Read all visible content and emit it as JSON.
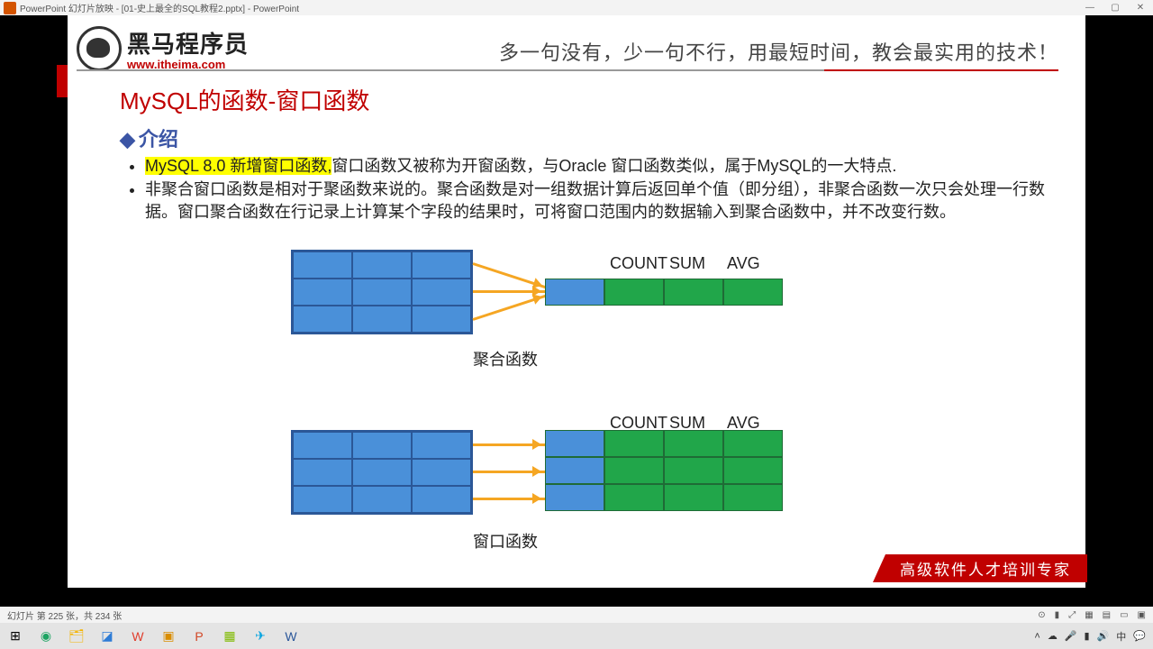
{
  "window": {
    "title": "PowerPoint 幻灯片放映 - [01-史上最全的SQL教程2.pptx] - PowerPoint"
  },
  "brand": {
    "name": "黑马程序员",
    "url": "www.itheima.com"
  },
  "tagline": "多一句没有，少一句不行，用最短时间，教会最实用的技术！",
  "slide": {
    "title": "MySQL的函数-窗口函数",
    "section": "介绍",
    "bullet_hl": "MySQL 8.0 新增窗口函数,",
    "bullet1_rest": "窗口函数又被称为开窗函数，与Oracle 窗口函数类似，属于MySQL的一大特点.",
    "bullet2": "非聚合窗口函数是相对于聚函数来说的。聚合函数是对一组数据计算后返回单个值（即分组），非聚合函数一次只会处理一行数据。窗口聚合函数在行记录上计算某个字段的结果时，可将窗口范围内的数据输入到聚合函数中，并不改变行数。",
    "labels": {
      "count": "COUNT",
      "sum": "SUM",
      "avg": "AVG"
    },
    "caption1": "聚合函数",
    "caption2": "窗口函数",
    "ribbon": "高级软件人才培训专家"
  },
  "status": {
    "text": "幻灯片 第 225 张，共 234 张"
  },
  "tray": {
    "time": "",
    "icons": [
      "^",
      "☁",
      "🔈",
      "中",
      "📶"
    ]
  }
}
